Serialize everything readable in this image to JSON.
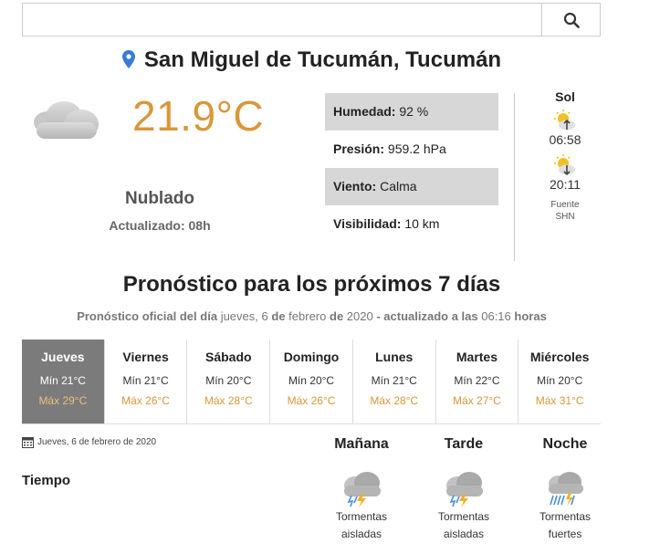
{
  "search": {
    "placeholder": "",
    "icon": "search-icon"
  },
  "location": {
    "name": "San Miguel de Tucumán, Tucumán",
    "icon": "map-pin-icon",
    "pin_color": "#3a7bd5"
  },
  "current": {
    "icon": "cloud-icon",
    "temperature": "21.9°C",
    "condition": "Nublado",
    "updated": "Actualizado: 08h",
    "temp_color": "#d9973a"
  },
  "details": [
    {
      "label": "Humedad:",
      "value": "92 %"
    },
    {
      "label": "Presión:",
      "value": "959.2 hPa"
    },
    {
      "label": "Viento:",
      "value": "Calma"
    },
    {
      "label": "Visibilidad:",
      "value": "10 km"
    }
  ],
  "sun": {
    "title": "Sol",
    "sunrise": "06:58",
    "sunset": "20:11",
    "source_label": "Fuente",
    "source": "SHN"
  },
  "forecast": {
    "title": "Pronóstico para los próximos 7 días",
    "subtitle": {
      "prefix": "Pronóstico oficial del día",
      "weekday": "jueves,",
      "day": "6",
      "de1": "de",
      "month": "febrero",
      "de2": "de",
      "year": "2020",
      "updated_label": "- actualizado a las",
      "time": "06:16",
      "suffix": "horas"
    },
    "days": [
      {
        "name": "Jueves",
        "min": "Mín 21°C",
        "max": "Máx 29°C"
      },
      {
        "name": "Viernes",
        "min": "Mín 21°C",
        "max": "Máx 26°C"
      },
      {
        "name": "Sábado",
        "min": "Mín 20°C",
        "max": "Máx 28°C"
      },
      {
        "name": "Domingo",
        "min": "Mín 20°C",
        "max": "Máx 26°C"
      },
      {
        "name": "Lunes",
        "min": "Mín 21°C",
        "max": "Máx 28°C"
      },
      {
        "name": "Martes",
        "min": "Mín 22°C",
        "max": "Máx 27°C"
      },
      {
        "name": "Miércoles",
        "min": "Mín 20°C",
        "max": "Máx 31°C"
      }
    ],
    "active_day": "Jueves"
  },
  "detail_day": {
    "date": "Jueves, 6 de febrero de 2020",
    "row_label": "Tiempo",
    "periods": [
      {
        "name": "Mañana",
        "icon": "storm-cloud-icon",
        "line1": "Tormentas",
        "line2": "aisladas"
      },
      {
        "name": "Tarde",
        "icon": "storm-cloud-icon",
        "line1": "Tormentas",
        "line2": "aisladas"
      },
      {
        "name": "Noche",
        "icon": "heavy-storm-icon",
        "line1": "Tormentas",
        "line2": "fuertes"
      }
    ]
  }
}
